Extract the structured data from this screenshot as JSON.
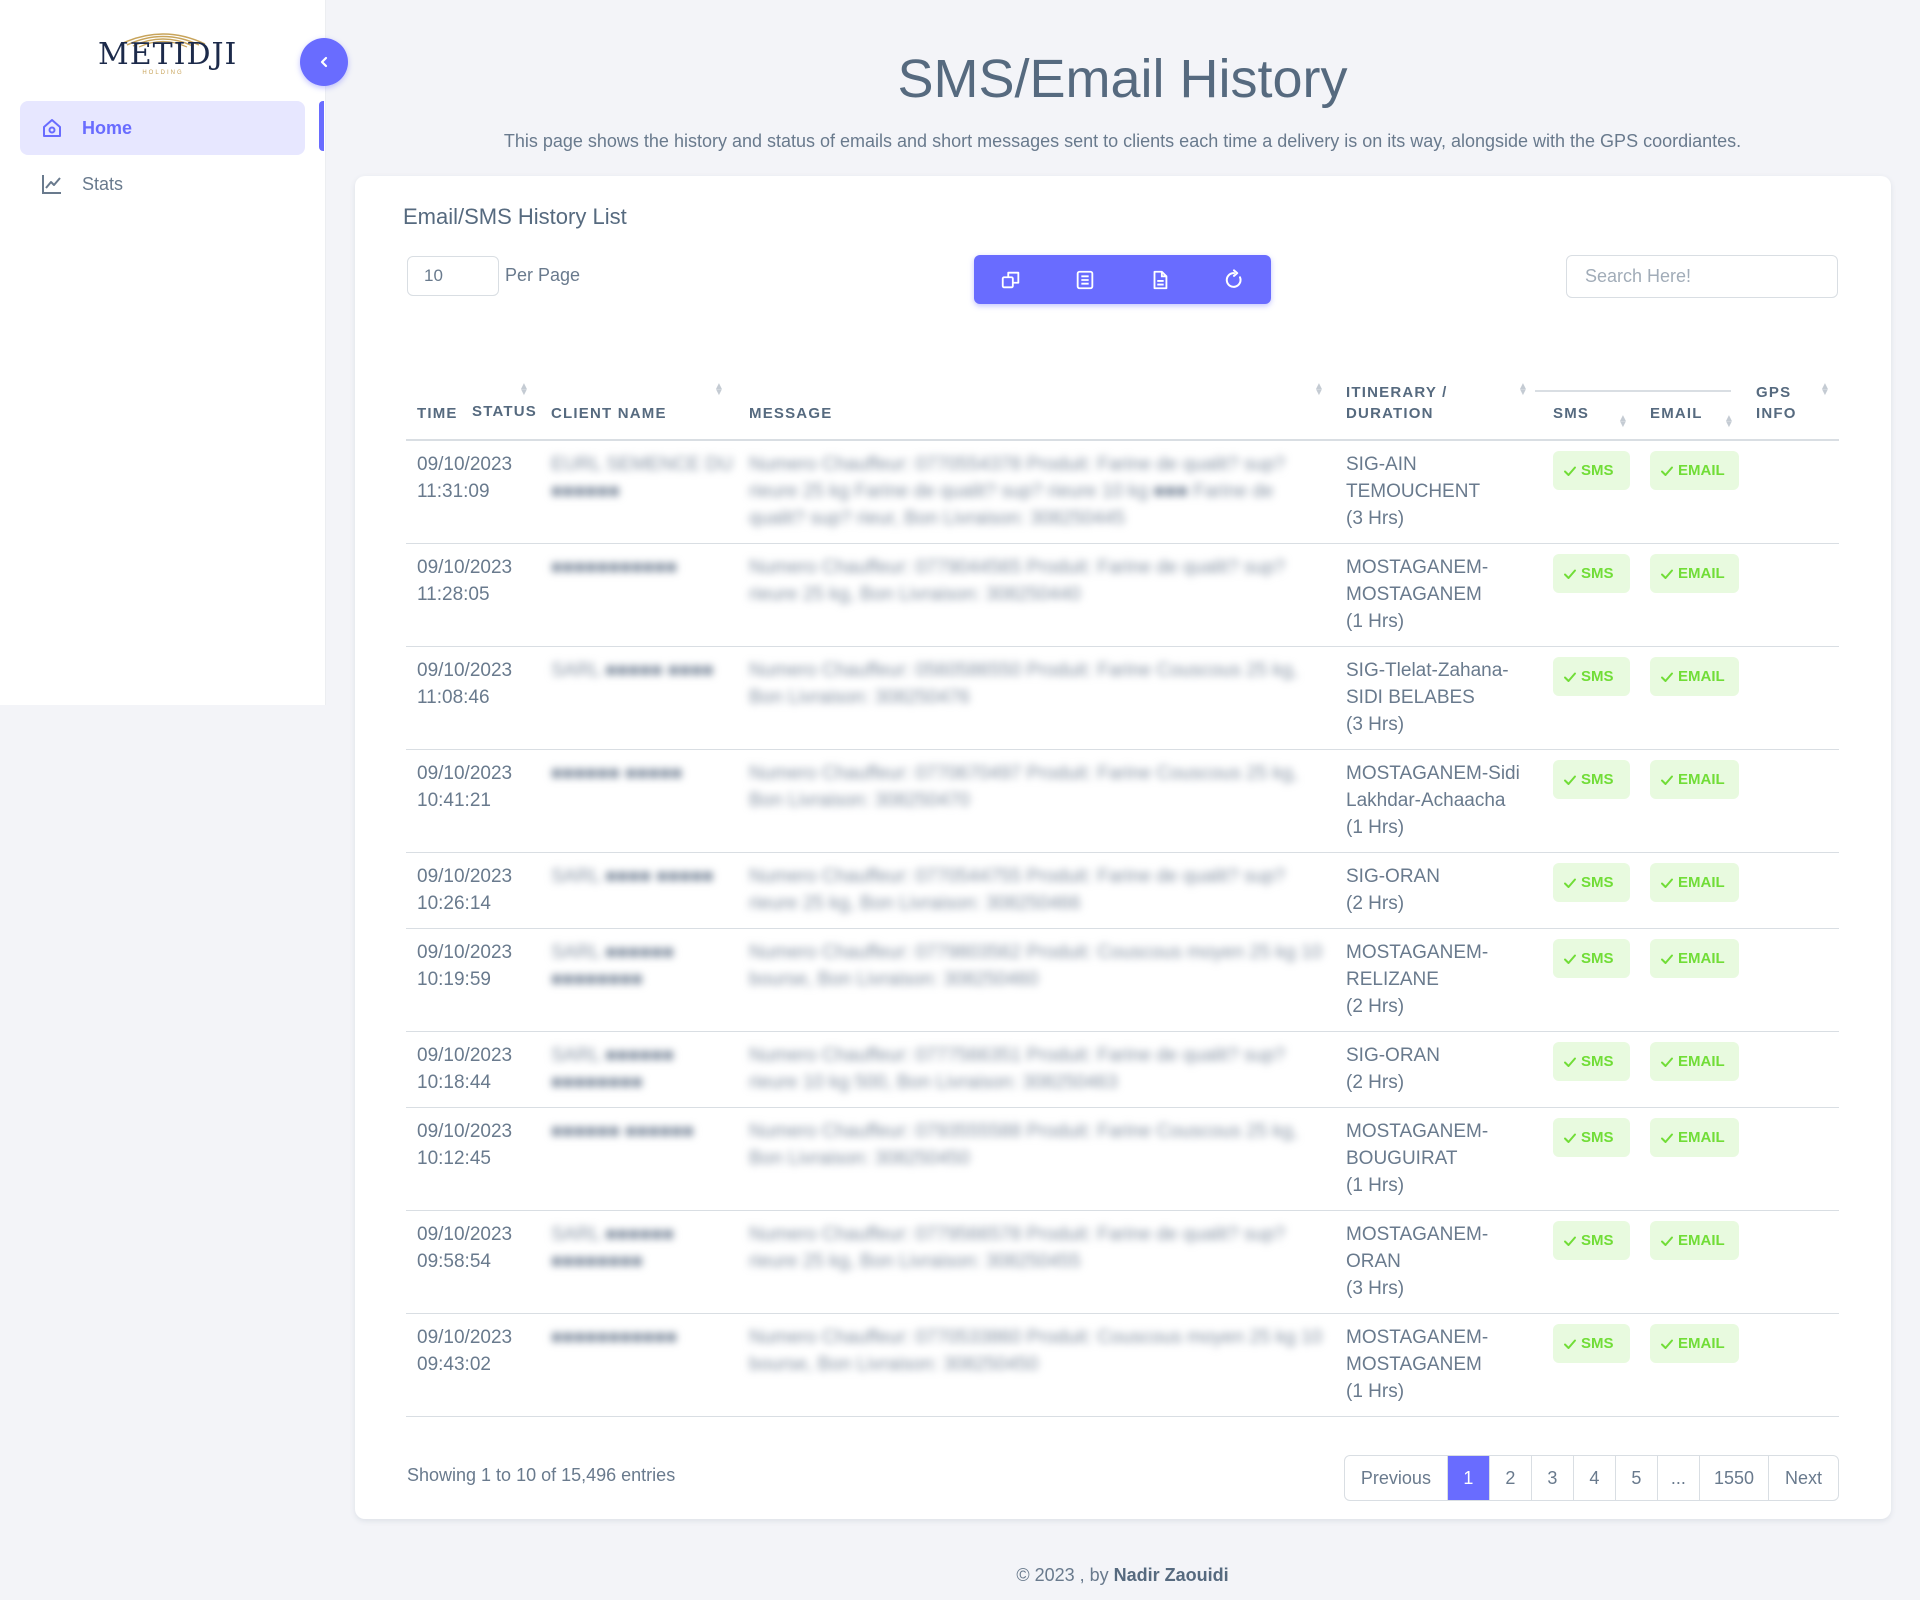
{
  "brand": {
    "name": "METIDJI",
    "subtitle": "HOLDING"
  },
  "sidebar": {
    "items": [
      {
        "label": "Home",
        "icon": "home-icon",
        "active": true
      },
      {
        "label": "Stats",
        "icon": "chart-line-icon",
        "active": false
      }
    ]
  },
  "header": {
    "title": "SMS/Email History",
    "description": "This page shows the history and status of emails and short messages sent to clients each time a delivery is on its way, alongside with the GPS coordiantes."
  },
  "card": {
    "title": "Email/SMS History List",
    "per_page_value": "10",
    "per_page_label": "Per Page",
    "search_placeholder": "Search Here!",
    "toolbar_icons": [
      "copy-icon",
      "csv-icon",
      "file-icon",
      "refresh-icon"
    ]
  },
  "table": {
    "headers": {
      "time": "TIME",
      "client": "CLIENT NAME",
      "message": "MESSAGE",
      "itinerary": "ITINERARY /",
      "itinerary2": "DURATION",
      "status": "STATUS",
      "sms": "SMS",
      "email": "EMAIL",
      "gps": "GPS",
      "gps2": "INFO"
    },
    "rows": [
      {
        "date": "09/10/2023",
        "time": "11:31:09",
        "client": "EURL SEMENCE DU ■■■■■■",
        "message": "Numero Chauffeur: 0770554378 Produit: Farine de qualit? sup? rieure 25 kg Farine de qualit? sup? rieure 10 kg ■■■ Farine de qualit? sup? rieur, Bon Livraison: 308250445",
        "itin1": "SIG-AIN",
        "itin2": "TEMOUCHENT",
        "itin3": "(3 Hrs)"
      },
      {
        "date": "09/10/2023",
        "time": "11:28:05",
        "client": "■■■■■■■■■■■",
        "message": "Numero Chauffeur: 0779044565 Produit: Farine de qualit? sup? rieure 25 kg, Bon Livraison: 308250440",
        "itin1": "MOSTAGANEM-",
        "itin2": "MOSTAGANEM",
        "itin3": "(1 Hrs)"
      },
      {
        "date": "09/10/2023",
        "time": "11:08:46",
        "client": "SARL ■■■■■ ■■■■",
        "message": "Numero Chauffeur: 0560586550 Produit: Farine Couscous 25 kg, Bon Livraison: 308250476",
        "itin1": "SIG-Tlelat-Zahana-",
        "itin2": "SIDI BELABES",
        "itin3": "(3 Hrs)"
      },
      {
        "date": "09/10/2023",
        "time": "10:41:21",
        "client": "■■■■■■ ■■■■■",
        "message": "Numero Chauffeur: 0770670497 Produit: Farine Couscous 25 kg, Bon Livraison: 308250470",
        "itin1": "MOSTAGANEM-Sidi",
        "itin2": "Lakhdar-Achaacha",
        "itin3": "(1 Hrs)"
      },
      {
        "date": "09/10/2023",
        "time": "10:26:14",
        "client": "SARL ■■■■ ■■■■■",
        "message": "Numero Chauffeur: 0770544755 Produit: Farine de qualit? sup? rieure 25 kg, Bon Livraison: 308250466",
        "itin1": "SIG-ORAN",
        "itin2": "(2 Hrs)",
        "itin3": ""
      },
      {
        "date": "09/10/2023",
        "time": "10:19:59",
        "client": "SARL ■■■■■■ ■■■■■■■■",
        "message": "Numero Chauffeur: 0779803562 Produit: Couscous moyen 25 kg 10 bourse, Bon Livraison: 308250460",
        "itin1": "MOSTAGANEM-",
        "itin2": "RELIZANE",
        "itin3": "(2 Hrs)"
      },
      {
        "date": "09/10/2023",
        "time": "10:18:44",
        "client": "SARL ■■■■■■ ■■■■■■■■",
        "message": "Numero Chauffeur: 0777566351 Produit: Farine de qualit? sup? rieure 10 kg 500, Bon Livraison: 308250463",
        "itin1": "SIG-ORAN",
        "itin2": "(2 Hrs)",
        "itin3": ""
      },
      {
        "date": "09/10/2023",
        "time": "10:12:45",
        "client": "■■■■■■ ■■■■■■",
        "message": "Numero Chauffeur: 0793555588 Produit: Farine Couscous 25 kg, Bon Livraison: 308250450",
        "itin1": "MOSTAGANEM-",
        "itin2": "BOUGUIRAT",
        "itin3": "(1 Hrs)"
      },
      {
        "date": "09/10/2023",
        "time": "09:58:54",
        "client": "SARL ■■■■■■ ■■■■■■■■",
        "message": "Numero Chauffeur: 0779566578 Produit: Farine de qualit? sup? rieure 25 kg, Bon Livraison: 308250455",
        "itin1": "MOSTAGANEM-",
        "itin2": "ORAN",
        "itin3": "(3 Hrs)"
      },
      {
        "date": "09/10/2023",
        "time": "09:43:02",
        "client": "■■■■■■■■■■■",
        "message": "Numero Chauffeur: 0770533860 Produit: Couscous moyen 25 kg 10 bourse, Bon Livraison: 308250450",
        "itin1": "MOSTAGANEM-",
        "itin2": "MOSTAGANEM",
        "itin3": "(1 Hrs)"
      }
    ],
    "badge_sms": "SMS",
    "badge_email": "EMAIL"
  },
  "pagination": {
    "showing": "Showing 1 to 10 of 15,496 entries",
    "previous": "Previous",
    "pages": [
      "1",
      "2",
      "3",
      "4",
      "5",
      "...",
      "1550"
    ],
    "next": "Next",
    "current": "1"
  },
  "footer": {
    "prefix": "© 2023 , by",
    "author": "Nadir Zaouidi"
  },
  "colors": {
    "accent": "#696cff",
    "success": "#71dd37",
    "success_bg": "#e8fadf",
    "text": "#566a7f"
  }
}
